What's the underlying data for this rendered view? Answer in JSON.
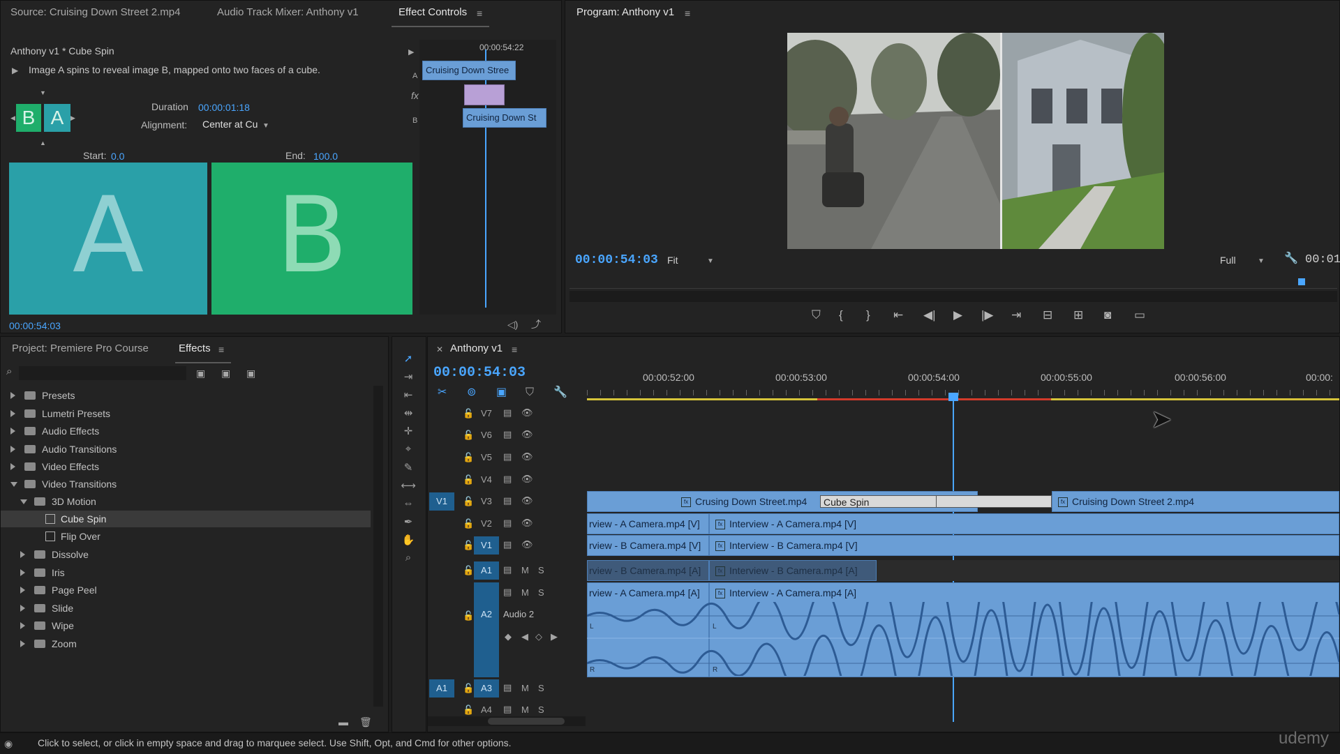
{
  "source_panel": {
    "tabs": [
      {
        "label": "Source: Cruising Down Street 2.mp4"
      },
      {
        "label": "Audio Track Mixer: Anthony v1"
      },
      {
        "label": "Effect Controls"
      }
    ],
    "clip_title": "Anthony v1 * Cube Spin",
    "description": "Image A spins to reveal image B, mapped onto two faces of a cube.",
    "duration_label": "Duration",
    "duration_value": "00:00:01:18",
    "alignment_label": "Alignment:",
    "alignment_value": "Center at Cu",
    "start_label": "Start:",
    "start_value": "0.0",
    "end_label": "End:",
    "end_value": "100.0",
    "preview_a": "A",
    "preview_b": "B",
    "thumb_b": "B",
    "thumb_a": "A",
    "timecode": "00:00:54:03",
    "mini_timeline": {
      "timecode": "00:00:54:22",
      "track_a": "A",
      "track_fx": "fx",
      "track_b": "B",
      "clip_a": "Cruising Down Stree",
      "clip_b": "Cruising Down St"
    }
  },
  "program_panel": {
    "title": "Program: Anthony v1",
    "timecode": "00:00:54:03",
    "fit": "Fit",
    "quality": "Full",
    "end_timecode": "00:01"
  },
  "project_panel": {
    "tabs": [
      {
        "label": "Project: Premiere Pro Course"
      },
      {
        "label": "Effects"
      }
    ],
    "tree": [
      {
        "label": "Presets",
        "level": 0,
        "expanded": false
      },
      {
        "label": "Lumetri Presets",
        "level": 0,
        "expanded": false
      },
      {
        "label": "Audio Effects",
        "level": 0,
        "expanded": false
      },
      {
        "label": "Audio Transitions",
        "level": 0,
        "expanded": false
      },
      {
        "label": "Video Effects",
        "level": 0,
        "expanded": false
      },
      {
        "label": "Video Transitions",
        "level": 0,
        "expanded": true
      },
      {
        "label": "3D Motion",
        "level": 1,
        "expanded": true
      },
      {
        "label": "Cube Spin",
        "level": 2,
        "selected": true
      },
      {
        "label": "Flip Over",
        "level": 2
      },
      {
        "label": "Dissolve",
        "level": 1,
        "expanded": false
      },
      {
        "label": "Iris",
        "level": 1,
        "expanded": false
      },
      {
        "label": "Page Peel",
        "level": 1,
        "expanded": false
      },
      {
        "label": "Slide",
        "level": 1,
        "expanded": false
      },
      {
        "label": "Wipe",
        "level": 1,
        "expanded": false
      },
      {
        "label": "Zoom",
        "level": 1,
        "expanded": false
      }
    ]
  },
  "timeline": {
    "sequence_name": "Anthony v1",
    "timecode": "00:00:54:03",
    "ruler": [
      "00:00:52:00",
      "00:00:53:00",
      "00:00:54:00",
      "00:00:55:00",
      "00:00:56:00",
      "00:00:"
    ],
    "tracks": {
      "v7": "V7",
      "v6": "V6",
      "v5": "V5",
      "v4": "V4",
      "v3": "V3",
      "v2": "V2",
      "v1": "V1",
      "v1_source": "V1",
      "a1": "A1",
      "a2": "A2",
      "a2_name": "Audio 2",
      "a3": "A3",
      "a4": "A4",
      "a1_source": "A1",
      "mute": "M",
      "solo": "S"
    },
    "clips": {
      "v3_left": "Crusing Down Street.mp4",
      "v3_transition": "Cube Spin",
      "v3_right": "Cruising Down Street 2.mp4",
      "v2_left": "rview - A Camera.mp4 [V]",
      "v2_right": "Interview - A Camera.mp4 [V]",
      "v1_left": "rview - B Camera.mp4 [V]",
      "v1_right": "Interview - B Camera.mp4 [V]",
      "a1_left": "rview - B Camera.mp4 [A]",
      "a1_right": "Interview - B Camera.mp4 [A]",
      "a2_left": "rview - A Camera.mp4 [A]",
      "a2_right": "Interview - A Camera.mp4 [A]",
      "channel_l": "L",
      "channel_r": "R"
    }
  },
  "status_bar": {
    "message": "Click to select, or click in empty space and drag to marquee select. Use Shift, Opt, and Cmd for other options.",
    "watermark": "udemy"
  },
  "colors": {
    "accent_blue": "#4aa6ff",
    "clip_blue": "#6a9ed6",
    "transition_a": "#2aa0a8",
    "transition_b": "#1fae6b"
  }
}
